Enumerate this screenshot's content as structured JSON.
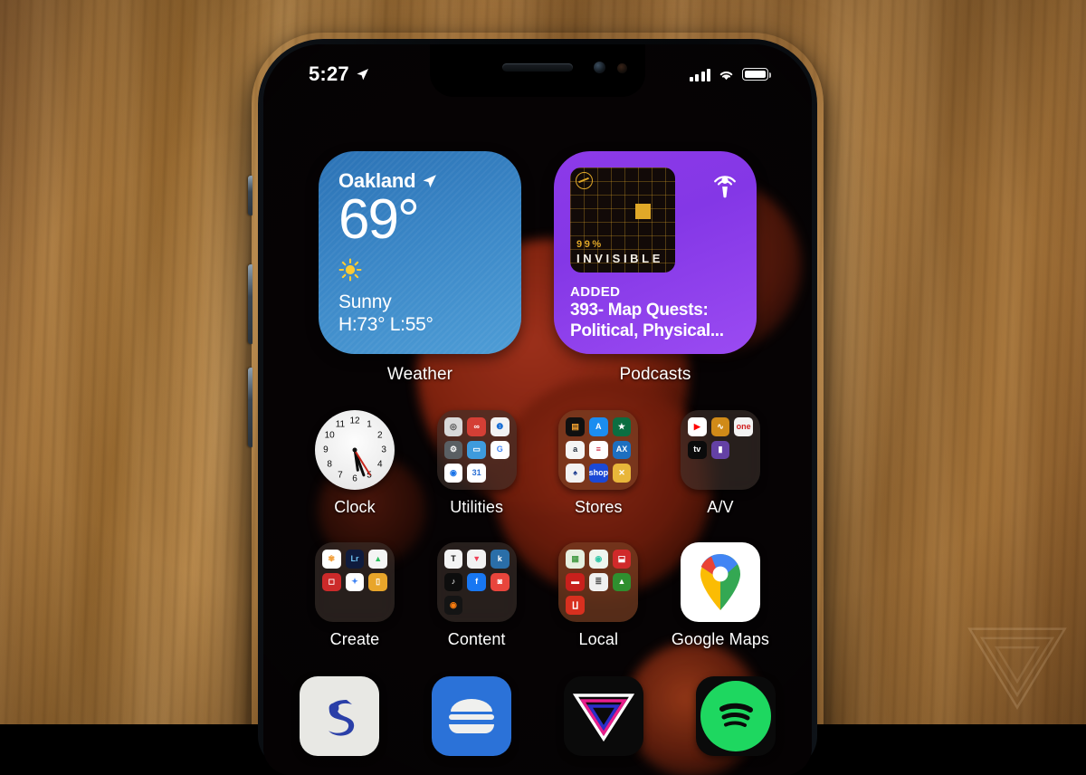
{
  "photo": {
    "subject": "iPhone home screen on wooden table",
    "watermark": "the-verge-logo"
  },
  "phone": {
    "status_bar": {
      "time": "5:27",
      "location_icon": "location-arrow-icon",
      "cellular_icon": "signal-bars-icon",
      "wifi_icon": "wifi-icon",
      "battery_icon": "battery-icon"
    },
    "widgets": [
      {
        "id": "weather",
        "label": "Weather",
        "city": "Oakland",
        "location_icon": "location-arrow-icon",
        "temperature": "69°",
        "condition_icon": "sun-icon",
        "condition": "Sunny",
        "high_low": "H:73° L:55°",
        "accent": "#3a86c6"
      },
      {
        "id": "podcasts",
        "label": "Podcasts",
        "status": "ADDED",
        "episode_title": "393- Map Quests: Political, Physical...",
        "artwork": {
          "show_number": "99%",
          "show_name": "INVISIBLE",
          "mark": "99pi-logo-icon"
        },
        "app_icon": "podcasts-icon",
        "accent": "#8d3ae8"
      }
    ],
    "rows": [
      {
        "apps": [
          {
            "name": "Clock",
            "type": "clock",
            "clock": {
              "hour_angle": 172,
              "minute_angle": 160,
              "second_angle": 148
            }
          },
          {
            "name": "Utilities",
            "type": "folder",
            "tint": "dark",
            "minis": [
              {
                "n": "shortcuts-icon",
                "bg": "#d8d8d8",
                "fg": "#4a4a4a",
                "t": "◎"
              },
              {
                "n": "last-pass-icon",
                "bg": "#d43f35",
                "fg": "#ffffff",
                "t": "∞"
              },
              {
                "n": "1password-icon",
                "bg": "#f2f2f2",
                "fg": "#1a6fd4",
                "t": "❶"
              },
              {
                "n": "authy-icon",
                "bg": "#5a5f63",
                "fg": "#ffffff",
                "t": "⚙"
              },
              {
                "n": "files-icon",
                "bg": "#3e9bdd",
                "fg": "#ffffff",
                "t": "▭"
              },
              {
                "n": "google-icon",
                "bg": "#ffffff",
                "fg": "#4285f4",
                "t": "G"
              },
              {
                "n": "chrome-icon",
                "bg": "#ffffff",
                "fg": "#1a73e8",
                "t": "◉"
              },
              {
                "n": "calendar-icon",
                "bg": "#ffffff",
                "fg": "#2a6fd4",
                "t": "31"
              },
              {
                "n": "empty",
                "bg": "transparent",
                "fg": "#fff",
                "t": ""
              }
            ]
          },
          {
            "name": "Stores",
            "type": "folder",
            "tint": "warm",
            "minis": [
              {
                "n": "wallet-icon",
                "bg": "#101010",
                "fg": "#f0a030",
                "t": "▤"
              },
              {
                "n": "app-store-icon",
                "bg": "#1b8df0",
                "fg": "#ffffff",
                "t": "A"
              },
              {
                "n": "starbucks-icon",
                "bg": "#0b6e41",
                "fg": "#ffffff",
                "t": "★"
              },
              {
                "n": "amazon-icon",
                "bg": "#f5f5f5",
                "fg": "#232f3e",
                "t": "a"
              },
              {
                "n": "delta-icon",
                "bg": "#ffffff",
                "fg": "#c8102e",
                "t": "≡"
              },
              {
                "n": "amex-icon",
                "bg": "#1d6fc0",
                "fg": "#ffffff",
                "t": "AX"
              },
              {
                "n": "bonobos-icon",
                "bg": "#f2f2f2",
                "fg": "#1a3a8f",
                "t": "♠"
              },
              {
                "n": "shop-icon",
                "bg": "#1b49d6",
                "fg": "#ffffff",
                "t": "shop"
              },
              {
                "n": "xfinity-icon",
                "bg": "#e8b63a",
                "fg": "#ffffff",
                "t": "✕"
              }
            ]
          },
          {
            "name": "A/V",
            "type": "folder",
            "tint": "dark",
            "minis": [
              {
                "n": "youtube-icon",
                "bg": "#ffffff",
                "fg": "#ff0000",
                "t": "▶"
              },
              {
                "n": "sonos-icon",
                "bg": "#d08a18",
                "fg": "#ffffff",
                "t": "∿"
              },
              {
                "n": "one-remote-icon",
                "bg": "#f2f2f2",
                "fg": "#d02020",
                "t": "one"
              },
              {
                "n": "apple-tv-icon",
                "bg": "#0b0b0b",
                "fg": "#ffffff",
                "t": "tv"
              },
              {
                "n": "twitch-icon",
                "bg": "#6441a5",
                "fg": "#ffffff",
                "t": "▮"
              },
              {
                "n": "empty",
                "bg": "transparent",
                "fg": "#fff",
                "t": ""
              },
              {
                "n": "empty",
                "bg": "transparent",
                "fg": "#fff",
                "t": ""
              },
              {
                "n": "empty",
                "bg": "transparent",
                "fg": "#fff",
                "t": ""
              },
              {
                "n": "empty",
                "bg": "transparent",
                "fg": "#fff",
                "t": ""
              }
            ]
          }
        ]
      },
      {
        "apps": [
          {
            "name": "Create",
            "type": "folder",
            "tint": "dark",
            "minis": [
              {
                "n": "photos-icon",
                "bg": "#ffffff",
                "fg": "#f2a03d",
                "t": "✾"
              },
              {
                "n": "lightroom-icon",
                "bg": "#0f1b3d",
                "fg": "#6fc3f2",
                "t": "Lr"
              },
              {
                "n": "evernote-icon",
                "bg": "#f4f4f4",
                "fg": "#2dbe60",
                "t": "▲"
              },
              {
                "n": "halide-icon",
                "bg": "#cc2a2a",
                "fg": "#ffffff",
                "t": "◻"
              },
              {
                "n": "google-photos-icon",
                "bg": "#ffffff",
                "fg": "#4285f4",
                "t": "✦"
              },
              {
                "n": "vsco-icon",
                "bg": "#e8a52a",
                "fg": "#ffffff",
                "t": "▯"
              },
              {
                "n": "empty",
                "bg": "transparent",
                "fg": "#fff",
                "t": ""
              },
              {
                "n": "empty",
                "bg": "transparent",
                "fg": "#fff",
                "t": ""
              },
              {
                "n": "empty",
                "bg": "transparent",
                "fg": "#fff",
                "t": ""
              }
            ]
          },
          {
            "name": "Content",
            "type": "folder",
            "tint": "dark",
            "minis": [
              {
                "n": "new-york-times-icon",
                "bg": "#f4f4f4",
                "fg": "#111111",
                "t": "T"
              },
              {
                "n": "pocket-icon",
                "bg": "#f2f2f2",
                "fg": "#ee4056",
                "t": "▼"
              },
              {
                "n": "kindle-icon",
                "bg": "#2a6ea8",
                "fg": "#ffffff",
                "t": "k"
              },
              {
                "n": "tiktok-icon",
                "bg": "#0d0d0d",
                "fg": "#ffffff",
                "t": "♪"
              },
              {
                "n": "facebook-icon",
                "bg": "#1877f2",
                "fg": "#ffffff",
                "t": "f"
              },
              {
                "n": "instagram-icon",
                "bg": "#e8453c",
                "fg": "#ffffff",
                "t": "◙"
              },
              {
                "n": "overcast-icon",
                "bg": "#141414",
                "fg": "#fc7e0f",
                "t": "◉"
              },
              {
                "n": "empty",
                "bg": "transparent",
                "fg": "#fff",
                "t": ""
              },
              {
                "n": "empty",
                "bg": "transparent",
                "fg": "#fff",
                "t": ""
              }
            ]
          },
          {
            "name": "Local",
            "type": "folder",
            "tint": "warm",
            "minis": [
              {
                "n": "apple-maps-icon",
                "bg": "#e6f0e0",
                "fg": "#4c9f4c",
                "t": "▦"
              },
              {
                "n": "waze-icon",
                "bg": "#eef5ee",
                "fg": "#33c7a8",
                "t": "◉"
              },
              {
                "n": "bart-icon",
                "bg": "#d02a2a",
                "fg": "#ffffff",
                "t": "⬓"
              },
              {
                "n": "caltrain-icon",
                "bg": "#c8201c",
                "fg": "#ffffff",
                "t": "▬"
              },
              {
                "n": "transit-icon",
                "bg": "#f0f0f0",
                "fg": "#555555",
                "t": "≣"
              },
              {
                "n": "alltrails-icon",
                "bg": "#2f8f2f",
                "fg": "#ffffff",
                "t": "▲"
              },
              {
                "n": "under-armour-icon",
                "bg": "#d8301f",
                "fg": "#ffffff",
                "t": "∐"
              },
              {
                "n": "empty",
                "bg": "transparent",
                "fg": "#fff",
                "t": ""
              },
              {
                "n": "empty",
                "bg": "transparent",
                "fg": "#fff",
                "t": ""
              }
            ]
          },
          {
            "name": "Google Maps",
            "type": "gmaps"
          }
        ]
      }
    ],
    "dock": [
      {
        "name": "simple-icon",
        "bg": "#e8e8e4"
      },
      {
        "name": "burger-app-icon",
        "bg": "#2b72d8"
      },
      {
        "name": "the-verge-icon",
        "bg": "#0a0a0a"
      },
      {
        "name": "spotify-icon",
        "bg": "#0a0a0a"
      }
    ]
  }
}
